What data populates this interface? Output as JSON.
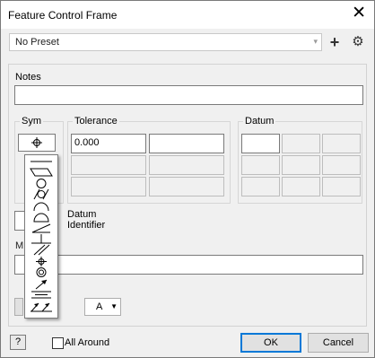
{
  "window": {
    "title": "Feature Control Frame",
    "close_glyph": "✕"
  },
  "preset": {
    "value": "No Preset",
    "arrow_glyph": "▾",
    "plus_glyph": "+",
    "gear_glyph": "⚙"
  },
  "notes": {
    "label": "Notes",
    "value": ""
  },
  "sym": {
    "label": "Sym",
    "selected_icon": "position-icon",
    "selected_glyph": "⌖"
  },
  "tolerance": {
    "label": "Tolerance",
    "value": "0.000"
  },
  "datum": {
    "label": "Datum"
  },
  "symbol_list": [
    "straightness-icon",
    "flatness-icon",
    "circularity-icon",
    "cylindricity-icon",
    "line-profile-icon",
    "surface-profile-icon",
    "angularity-icon",
    "perpendicularity-icon",
    "parallelism-icon",
    "position-icon",
    "concentricity-icon",
    "circular-runout-icon",
    "symmetry-icon",
    "total-runout-icon"
  ],
  "datum_identifier": {
    "line1": "Datum",
    "line2": "Identifier"
  },
  "partial_label": "M",
  "a_dropdown": {
    "value": "A",
    "arrow_glyph": "▼"
  },
  "footer": {
    "help_glyph": "?",
    "all_around_label": "All Around",
    "all_around_checked": false,
    "ok_label": "OK",
    "cancel_label": "Cancel"
  },
  "colors": {
    "accent": "#0078d7",
    "window_bg": "#f0f0f0"
  }
}
